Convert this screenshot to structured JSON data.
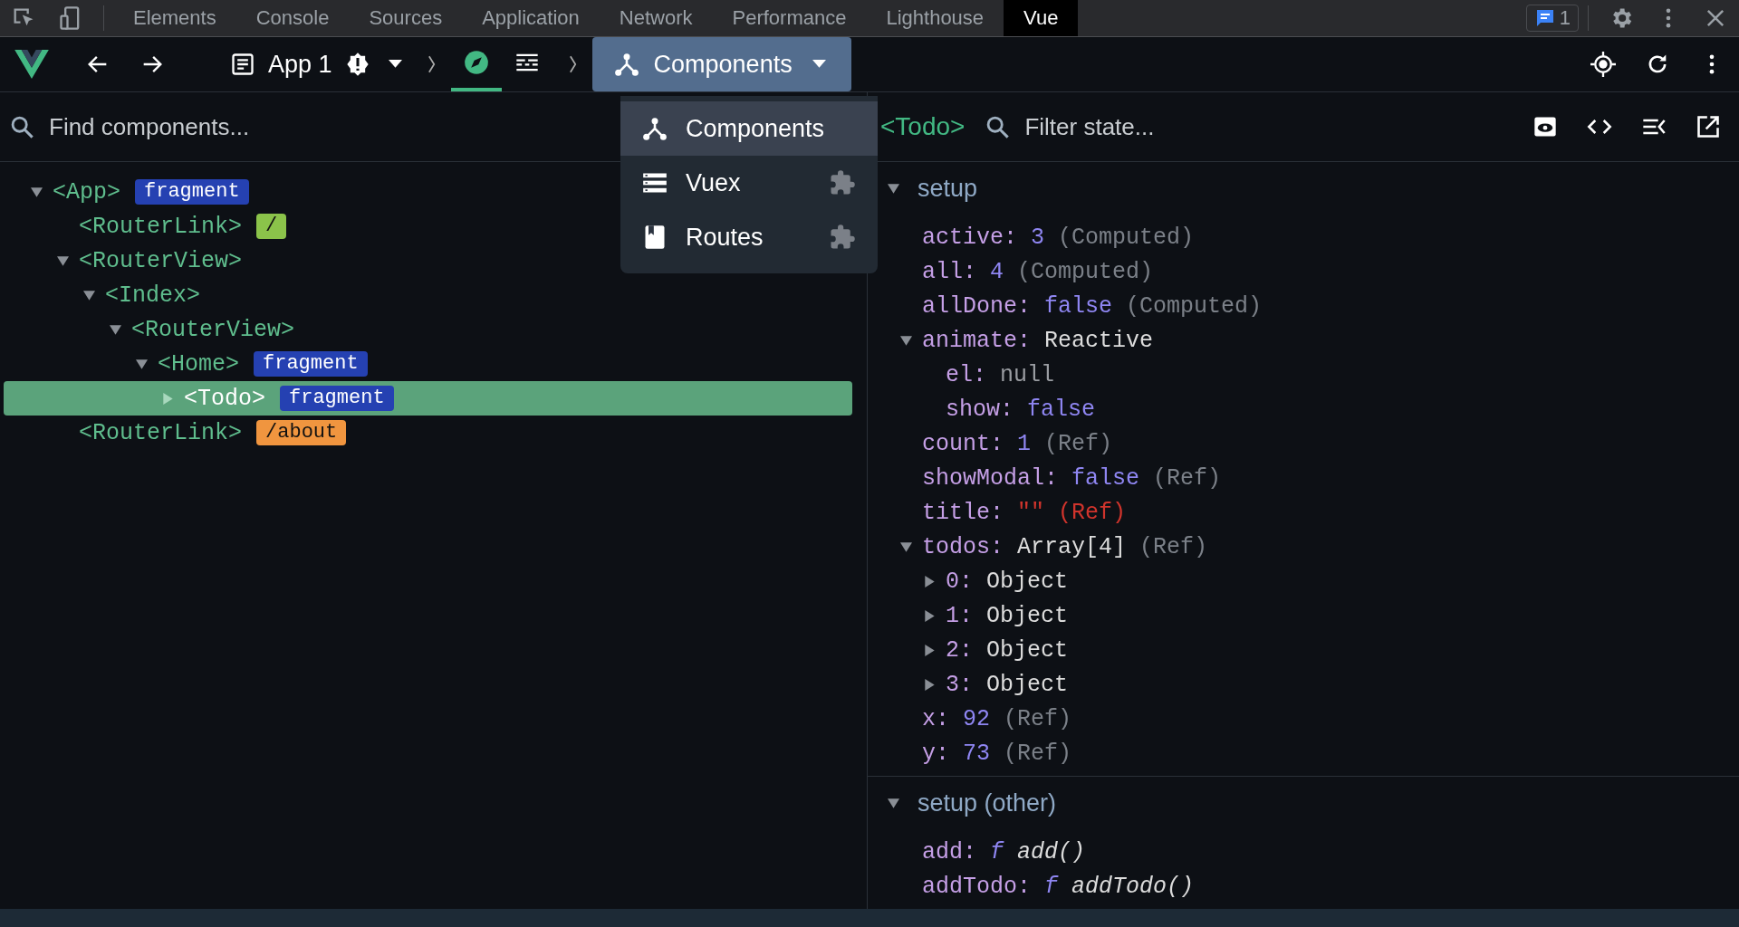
{
  "devtools_tabs": [
    {
      "label": "Elements",
      "selected": false
    },
    {
      "label": "Console",
      "selected": false
    },
    {
      "label": "Sources",
      "selected": false
    },
    {
      "label": "Application",
      "selected": false
    },
    {
      "label": "Network",
      "selected": false
    },
    {
      "label": "Performance",
      "selected": false
    },
    {
      "label": "Lighthouse",
      "selected": false
    },
    {
      "label": "Vue",
      "selected": true
    }
  ],
  "messages_badge": "1",
  "toolbar": {
    "app_selector": "App 1",
    "view_tabs": [
      {
        "kind": "inspector",
        "selected": true
      },
      {
        "kind": "timeline",
        "selected": false
      }
    ],
    "view_selector": "Components"
  },
  "view_menu": [
    {
      "kind": "components",
      "label": "Components",
      "selected": true,
      "plugin": false
    },
    {
      "kind": "vuex",
      "label": "Vuex",
      "selected": false,
      "plugin": true
    },
    {
      "kind": "routes",
      "label": "Routes",
      "selected": false,
      "plugin": true
    }
  ],
  "tree": {
    "search": {
      "placeholder": "Find components..."
    },
    "nodes": [
      {
        "name": "<App>",
        "expanded": true,
        "selected": false,
        "tag": {
          "text": "fragment",
          "color": "#2541b2"
        },
        "children": [
          {
            "name": "<RouterLink>",
            "selected": false,
            "tag": {
              "text": "/",
              "color": "#8bc34a"
            }
          },
          {
            "name": "<RouterView>",
            "expanded": true,
            "selected": false,
            "children": [
              {
                "name": "<Index>",
                "expanded": true,
                "selected": false,
                "children": [
                  {
                    "name": "<RouterView>",
                    "expanded": true,
                    "selected": false,
                    "children": [
                      {
                        "name": "<Home>",
                        "expanded": true,
                        "selected": false,
                        "tag": {
                          "text": "fragment",
                          "color": "#2541b2"
                        },
                        "children": [
                          {
                            "name": "<Todo>",
                            "expanded": false,
                            "selected": true,
                            "tag": {
                              "text": "fragment",
                              "color": "#2541b2"
                            }
                          }
                        ]
                      }
                    ]
                  }
                ]
              }
            ]
          },
          {
            "name": "<RouterLink>",
            "selected": false,
            "tag": {
              "text": "/about",
              "color": "#f0953f"
            }
          }
        ]
      }
    ]
  },
  "inspector": {
    "component": "<Todo>",
    "filter": {
      "placeholder": "Filter state..."
    },
    "sections": [
      {
        "title": "setup",
        "expanded": true,
        "props": [
          {
            "key": "active:",
            "value": "3",
            "kind": "number",
            "note": "(Computed)"
          },
          {
            "key": "all:",
            "value": "4",
            "kind": "number",
            "note": "(Computed)"
          },
          {
            "key": "allDone:",
            "value": "false",
            "kind": "boolean",
            "note": "(Computed)"
          },
          {
            "key": "animate:",
            "value": "Reactive",
            "kind": "object",
            "expanded": true,
            "children": [
              {
                "key": "el:",
                "value": "null",
                "kind": "null"
              },
              {
                "key": "show:",
                "value": "false",
                "kind": "boolean"
              }
            ]
          },
          {
            "key": "count:",
            "value": "1",
            "kind": "number",
            "note": "(Ref)"
          },
          {
            "key": "showModal:",
            "value": "false",
            "kind": "boolean",
            "note": "(Ref)"
          },
          {
            "key": "title:",
            "value": "\"\"",
            "kind": "string",
            "note": "(Ref)"
          },
          {
            "key": "todos:",
            "value": "Array[4]",
            "kind": "object",
            "note": "(Ref)",
            "expanded": true,
            "children": [
              {
                "key": "0:",
                "value": "Object",
                "kind": "object",
                "expanded": false
              },
              {
                "key": "1:",
                "value": "Object",
                "kind": "object",
                "expanded": false
              },
              {
                "key": "2:",
                "value": "Object",
                "kind": "object",
                "expanded": false
              },
              {
                "key": "3:",
                "value": "Object",
                "kind": "object",
                "expanded": false
              }
            ]
          },
          {
            "key": "x:",
            "value": "92",
            "kind": "number",
            "note": "(Ref)"
          },
          {
            "key": "y:",
            "value": "73",
            "kind": "number",
            "note": "(Ref)"
          }
        ]
      },
      {
        "title": "setup (other)",
        "expanded": true,
        "props": [
          {
            "key": "add:",
            "prefix": "f",
            "value": "add()",
            "kind": "function"
          },
          {
            "key": "addTodo:",
            "prefix": "f",
            "value": "addTodo()",
            "kind": "function"
          }
        ]
      }
    ]
  }
}
